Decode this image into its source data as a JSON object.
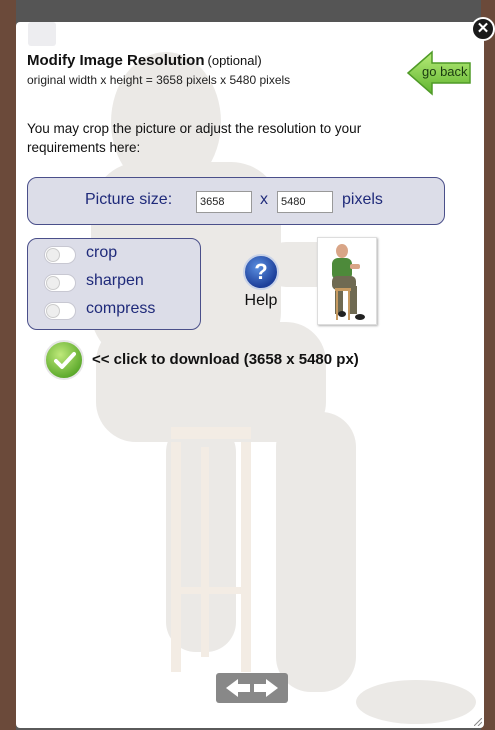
{
  "dialog": {
    "title": "Modify Image Resolution",
    "title_note": "(optional)",
    "subtitle": "original width x height = 3658 pixels x 5480 pixels",
    "intro": "You may crop the picture or adjust the resolution to your requirements here:"
  },
  "go_back": {
    "label": "go back"
  },
  "close": {
    "label": "✕"
  },
  "size": {
    "label": "Picture size:",
    "width": "3658",
    "height": "5480",
    "separator": "x",
    "unit": "pixels"
  },
  "options": [
    {
      "label": "crop",
      "enabled": false
    },
    {
      "label": "sharpen",
      "enabled": false
    },
    {
      "label": "compress",
      "enabled": false
    }
  ],
  "help": {
    "label": "Help",
    "icon": "question-mark-icon"
  },
  "download": {
    "label": "<< click to download (3658 x 5480 px)",
    "icon": "checkmark-icon"
  },
  "colors": {
    "panel_bg": "#dcdde8",
    "panel_border": "#4a4f8a",
    "panel_text": "#1f2a7a",
    "go_back_green": "#7bc84a",
    "download_green": "#5aa82a",
    "help_blue": "#1d3f9a"
  }
}
